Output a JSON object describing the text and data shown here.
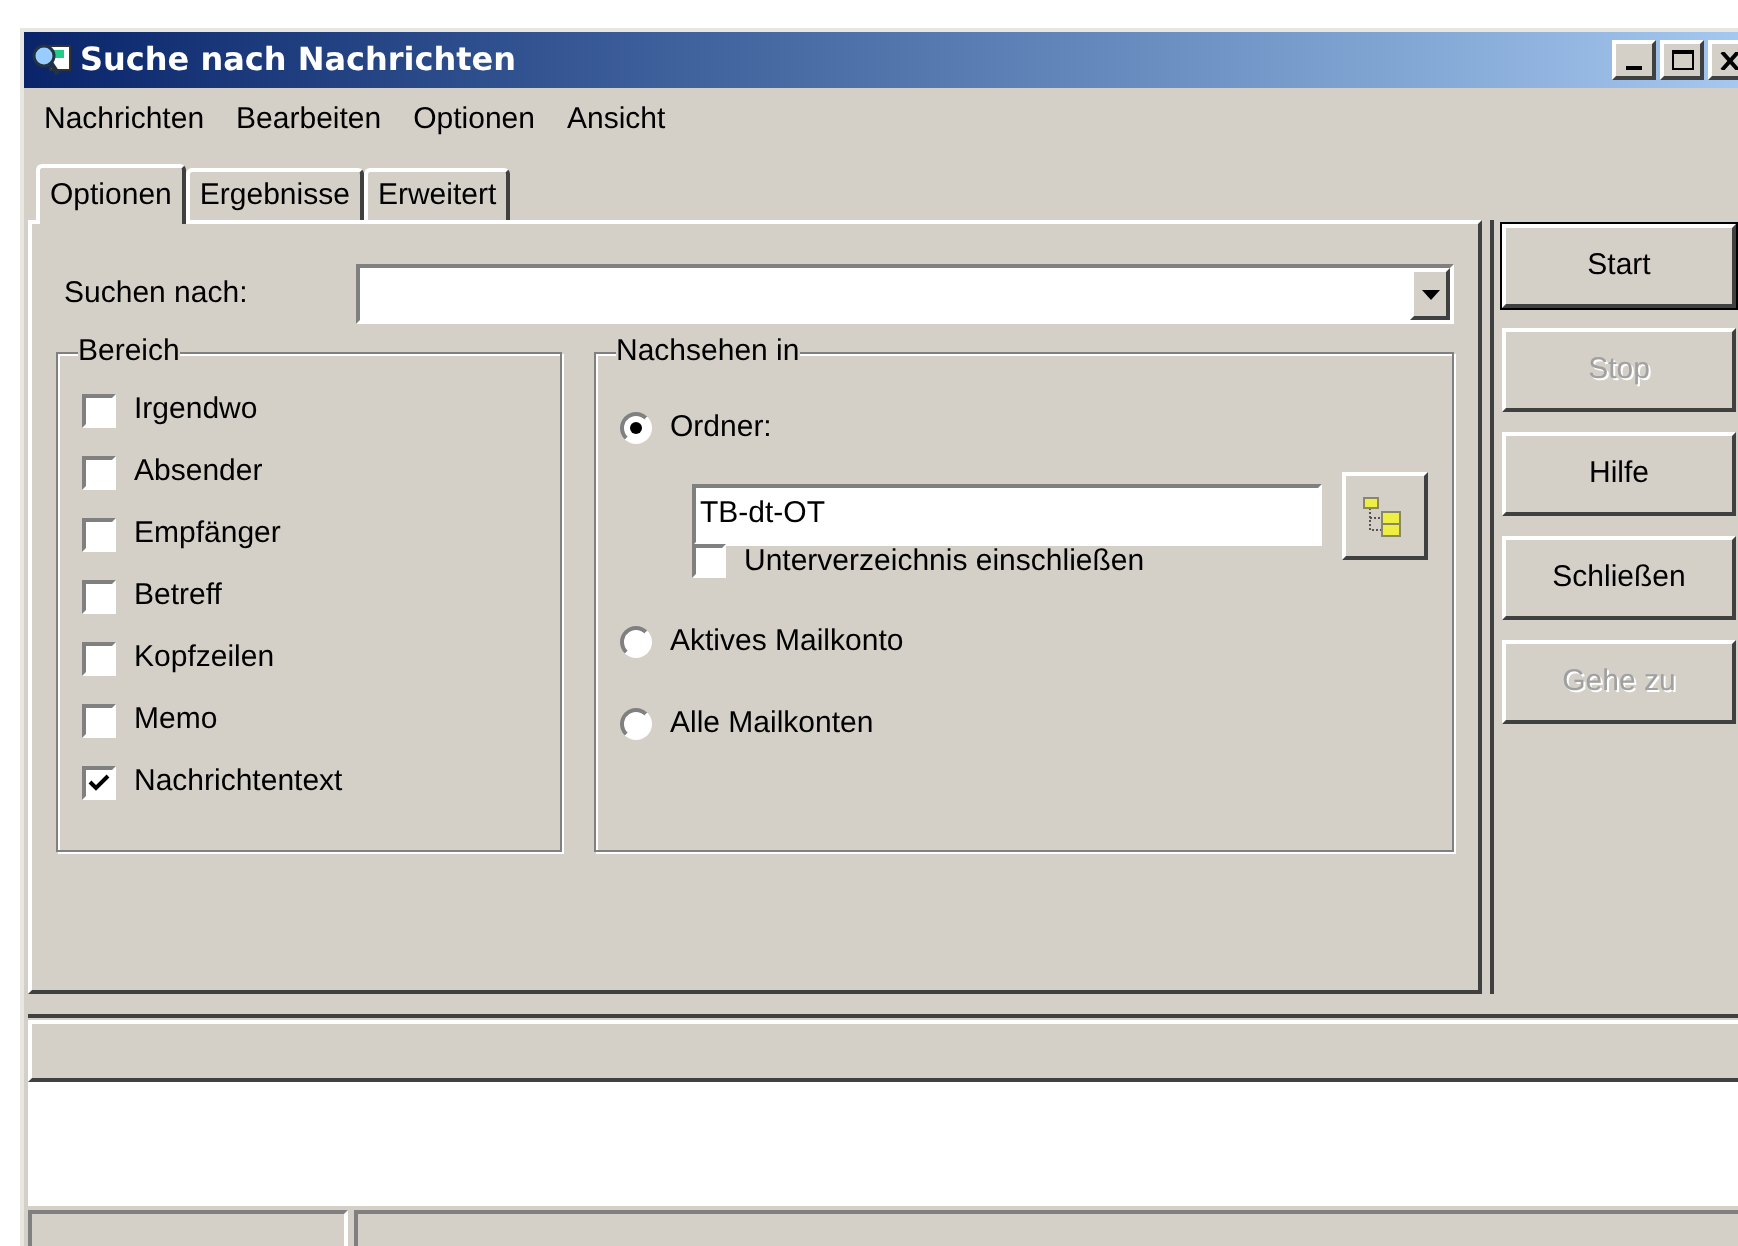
{
  "window": {
    "title": "Suche nach Nachrichten"
  },
  "menu": [
    "Nachrichten",
    "Bearbeiten",
    "Optionen",
    "Ansicht"
  ],
  "tabs": [
    {
      "label": "Optionen",
      "selected": true
    },
    {
      "label": "Ergebnisse",
      "selected": false
    },
    {
      "label": "Erweitert",
      "selected": false
    }
  ],
  "search": {
    "label": "Suchen nach:"
  },
  "bereich": {
    "title": "Bereich",
    "items": [
      {
        "label": "Irgendwo",
        "checked": false
      },
      {
        "label": "Absender",
        "checked": false
      },
      {
        "label": "Empfänger",
        "checked": false
      },
      {
        "label": "Betreff",
        "checked": false
      },
      {
        "label": "Kopfzeilen",
        "checked": false
      },
      {
        "label": "Memo",
        "checked": false
      },
      {
        "label": "Nachrichtentext",
        "checked": true
      }
    ]
  },
  "nachsehen": {
    "title": "Nachsehen in",
    "folder_option": {
      "label": "Ordner:",
      "selected": true
    },
    "folder_value": "TB-dt-OT",
    "subfolders": {
      "label": "Unterverzeichnis einschließen",
      "checked": false
    },
    "options": [
      {
        "label": "Aktives Mailkonto",
        "selected": false
      },
      {
        "label": "Alle Mailkonten",
        "selected": false
      }
    ]
  },
  "buttons": [
    {
      "label": "Start",
      "disabled": false,
      "default": true
    },
    {
      "label": "Stop",
      "disabled": true,
      "default": false
    },
    {
      "label": "Hilfe",
      "disabled": false,
      "default": false
    },
    {
      "label": "Schließen",
      "disabled": false,
      "default": false
    },
    {
      "label": "Gehe zu",
      "disabled": true,
      "default": false
    }
  ]
}
